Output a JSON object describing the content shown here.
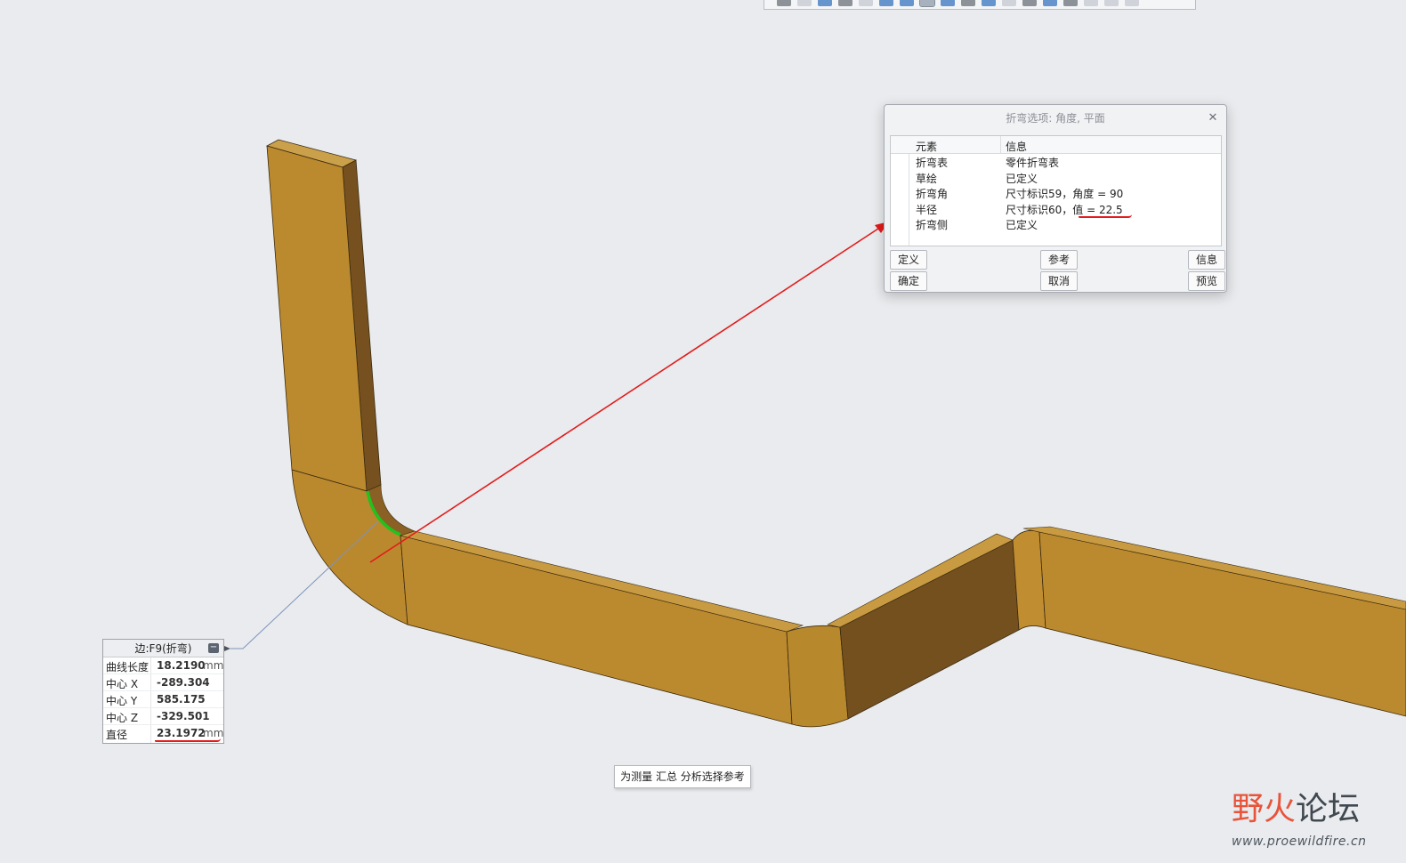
{
  "colors": {
    "background": "#e9ebee",
    "part_face": "#bc8a2e",
    "part_shadow": "#74501f",
    "highlight_edge": "#21c21f",
    "annotation_arrow": "#e21b1b",
    "leader_line": "#7d93bb"
  },
  "toolbar": {
    "icons": [
      "tool-icon",
      "tool-icon",
      "tool-icon",
      "tool-icon",
      "tool-icon",
      "tool-icon",
      "tool-icon",
      "tool-icon",
      "tool-icon",
      "tool-icon",
      "tool-icon",
      "tool-icon",
      "tool-icon",
      "tool-icon",
      "tool-icon",
      "tool-icon",
      "tool-icon",
      "tool-icon"
    ]
  },
  "dialog": {
    "title": "折弯选项: 角度, 平面",
    "close_icon": "close-icon",
    "columns": {
      "element": "元素",
      "info": "信息"
    },
    "rows": [
      {
        "element": "折弯表",
        "info": "零件折弯表"
      },
      {
        "element": "草绘",
        "info": "已定义"
      },
      {
        "element": "折弯角",
        "info": "尺寸标识59，角度 = 90"
      },
      {
        "element": "半径",
        "info": "尺寸标识60，值 = 22.5"
      },
      {
        "element": "折弯侧",
        "info": "已定义"
      }
    ],
    "buttons": {
      "define": "定义",
      "reference": "参考",
      "info": "信息",
      "ok": "确定",
      "cancel": "取消",
      "preview": "预览"
    }
  },
  "measure": {
    "title": "边:F9(折弯)",
    "collapse_icon": "minus-icon",
    "rows": [
      {
        "label": "曲线长度",
        "value": "18.2190",
        "unit": "mm"
      },
      {
        "label": "中心 X",
        "value": "-289.304",
        "unit": ""
      },
      {
        "label": "中心 Y",
        "value": "585.175",
        "unit": ""
      },
      {
        "label": "中心 Z",
        "value": "-329.501",
        "unit": ""
      },
      {
        "label": "直径",
        "value": "23.1972",
        "unit": "mm"
      }
    ]
  },
  "hint": "为测量 汇总 分析选择参考",
  "watermark": {
    "logo_part1": "野火",
    "logo_part2": "论坛",
    "url": "www.proewildfire.cn"
  }
}
